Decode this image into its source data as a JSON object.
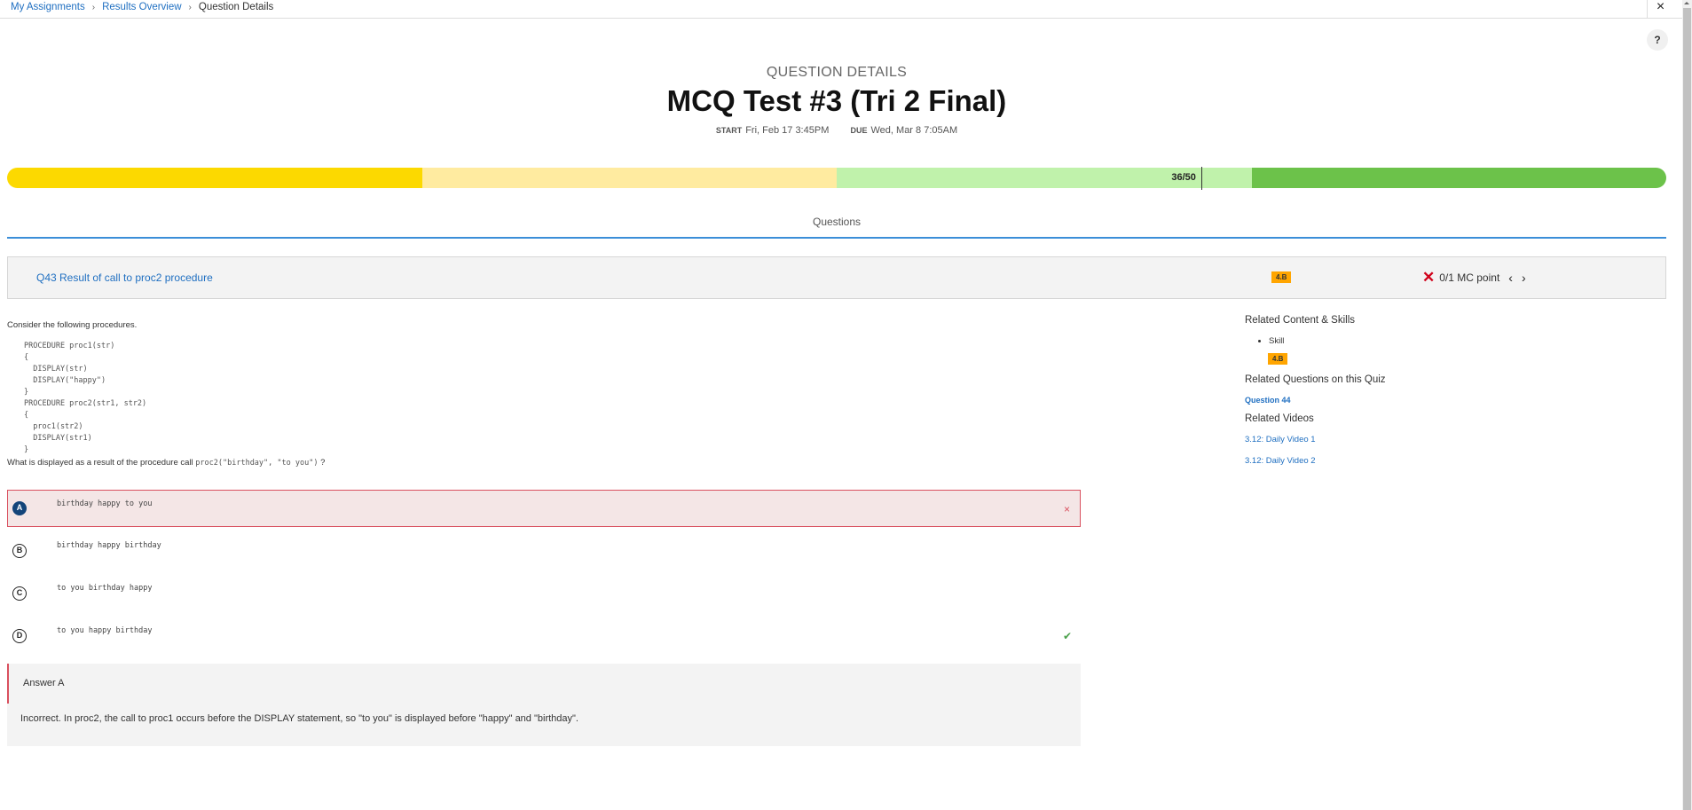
{
  "breadcrumb": {
    "items": [
      "My Assignments",
      "Results Overview"
    ],
    "current": "Question Details"
  },
  "icons": {
    "close": "×",
    "help": "?",
    "chevron_right": "›",
    "incorrect": "✕",
    "prev": "‹",
    "next": "›",
    "wrong_mark": "×",
    "correct_mark": "✔"
  },
  "header": {
    "overline": "QUESTION DETAILS",
    "title": "MCQ Test #3 (Tri 2 Final)",
    "start_label": "START",
    "start_value": "Fri, Feb 17 3:45PM",
    "due_label": "DUE",
    "due_value": "Wed, Mar 8 7:05AM"
  },
  "progress": {
    "score_text": "36/50",
    "score": 36,
    "total": 50,
    "segment_colors": [
      "#fcd900",
      "#ffeba0",
      "#c0f2ab",
      "#6cc24a"
    ]
  },
  "tabs": [
    {
      "label": "Questions"
    }
  ],
  "question": {
    "title": "Q43 Result of call to proc2 procedure",
    "badge": "4.B",
    "score_text": "0/1 MC point",
    "prompt": "Consider the following procedures.",
    "code": "PROCEDURE proc1(str)\n{\n  DISPLAY(str)\n  DISPLAY(\"happy\")\n}\nPROCEDURE proc2(str1, str2)\n{\n  proc1(str2)\n  DISPLAY(str1)\n}",
    "ask_before": "What is displayed as a result of the procedure call ",
    "ask_code": "proc2(\"birthday\", \"to you\")",
    "ask_after": " ?"
  },
  "choices": [
    {
      "letter": "A",
      "text": "birthday happy to you",
      "selected": true,
      "status": "wrong"
    },
    {
      "letter": "B",
      "text": "birthday happy birthday",
      "selected": false,
      "status": ""
    },
    {
      "letter": "C",
      "text": "to you birthday happy",
      "selected": false,
      "status": ""
    },
    {
      "letter": "D",
      "text": "to you happy birthday",
      "selected": false,
      "status": "correct"
    }
  ],
  "feedback": {
    "answer": "Answer A",
    "explanation": "Incorrect. In proc2, the call to proc1 occurs before the DISPLAY statement, so \"to you\" is displayed before \"happy\" and \"birthday\"."
  },
  "related": {
    "content_heading": "Related Content & Skills",
    "skill_label": "Skill",
    "skill_badge": "4.B",
    "questions_heading": "Related Questions on this Quiz",
    "question_link": "Question 44",
    "videos_heading": "Related Videos",
    "videos": [
      "3.12: Daily Video 1",
      "3.12: Daily Video 2"
    ]
  }
}
